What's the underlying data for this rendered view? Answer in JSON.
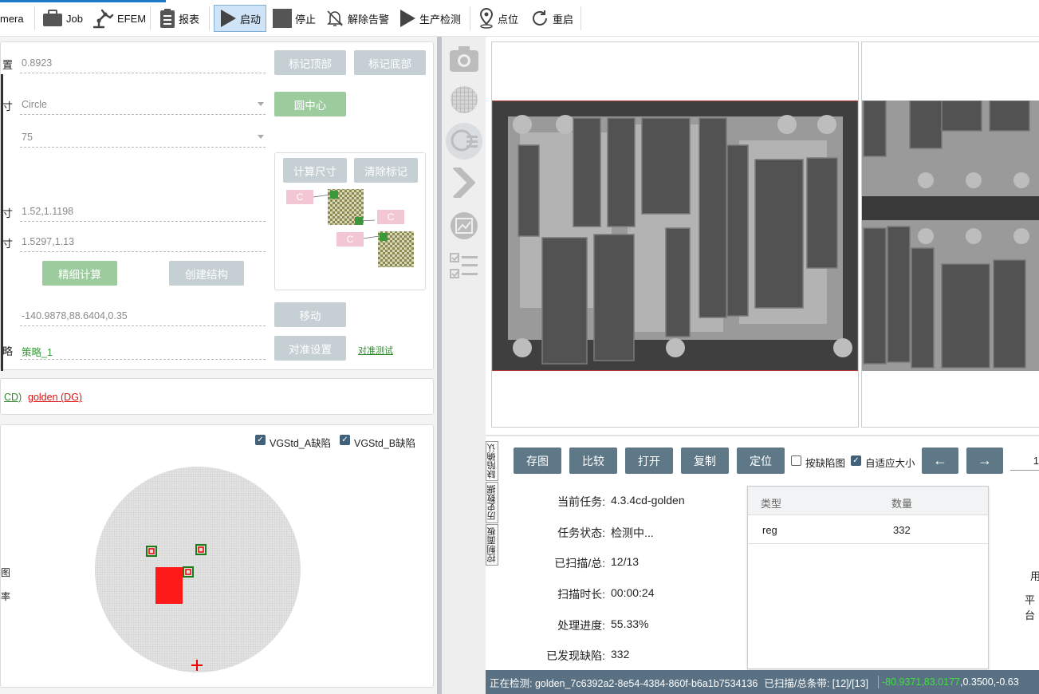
{
  "toolbar": {
    "camera": "mera",
    "job": "Job",
    "efem": "EFEM",
    "report": "报表",
    "start": "启动",
    "stop": "停止",
    "clear_alarm": "解除告警",
    "prod_check": "生产检测",
    "points": "点位",
    "restart": "重启"
  },
  "left": {
    "row1": {
      "label": "置",
      "value": "0.8923",
      "btn1": "标记顶部",
      "btn2": "标记底部"
    },
    "row2": {
      "label": "寸",
      "value": "Circle",
      "btn": "圆中心"
    },
    "row3": {
      "value": "75"
    },
    "calc": {
      "btn1": "计算尺寸",
      "btn2": "清除标记",
      "c": "C"
    },
    "row4": {
      "label": "寸",
      "value": "1.52,1.1198"
    },
    "row5": {
      "label": "寸",
      "value": "1.5297,1.13"
    },
    "fine": "精细计算",
    "create": "创建结构",
    "coord": {
      "value": "-140.9878,88.6404,0.35",
      "btn": "移动"
    },
    "strategy": {
      "label": "略",
      "value": "策略_1",
      "btn": "对准设置",
      "link": "对准测试"
    },
    "recipes": {
      "cd": "CD)",
      "golden": "golden (DG)"
    },
    "wafer": {
      "chk1": "VGStd_A缺陷",
      "chk2": "VGStd_B缺陷",
      "side_marks": [
        "图",
        "率"
      ]
    }
  },
  "right": {
    "buttons": [
      "存图",
      "比较",
      "打开",
      "复制",
      "定位"
    ],
    "chk_defect": "按缺陷图",
    "chk_fit": "自适应大小",
    "prev": "←",
    "next": "→",
    "page_partial": "1",
    "vtabs": [
      "缺陷确认",
      "历史数据",
      "控制面板"
    ],
    "info": [
      {
        "label": "当前任务:",
        "value": "4.3.4cd-golden"
      },
      {
        "label": "任务状态:",
        "value": "检测中..."
      },
      {
        "label": "已扫描/总:",
        "value": "12/13"
      },
      {
        "label": "扫描时长:",
        "value": "00:00:24"
      },
      {
        "label": "处理进度:",
        "value": "55.33%"
      },
      {
        "label": "已发现缺陷:",
        "value": "332"
      }
    ],
    "table": {
      "col1": "类型",
      "col2": "数量",
      "rows": [
        {
          "type": "reg",
          "count": "332"
        }
      ]
    },
    "side_cut": [
      "用",
      "平台"
    ]
  },
  "status": {
    "detecting": "正在检测: golden_7c6392a2-8e54-4384-860f-b6a1b7534136",
    "scanned": "已扫描/总条带: [12]/[13]",
    "coord_green": "-80.9371,83.0177",
    "coord_white": ",0.3500,-0.63"
  },
  "colors": {
    "accent": "#5e7887",
    "status_bg": "#597182",
    "green_btn": "#9ccc9e",
    "gray_btn": "#c5cfd4",
    "defect": "#ff0000"
  }
}
